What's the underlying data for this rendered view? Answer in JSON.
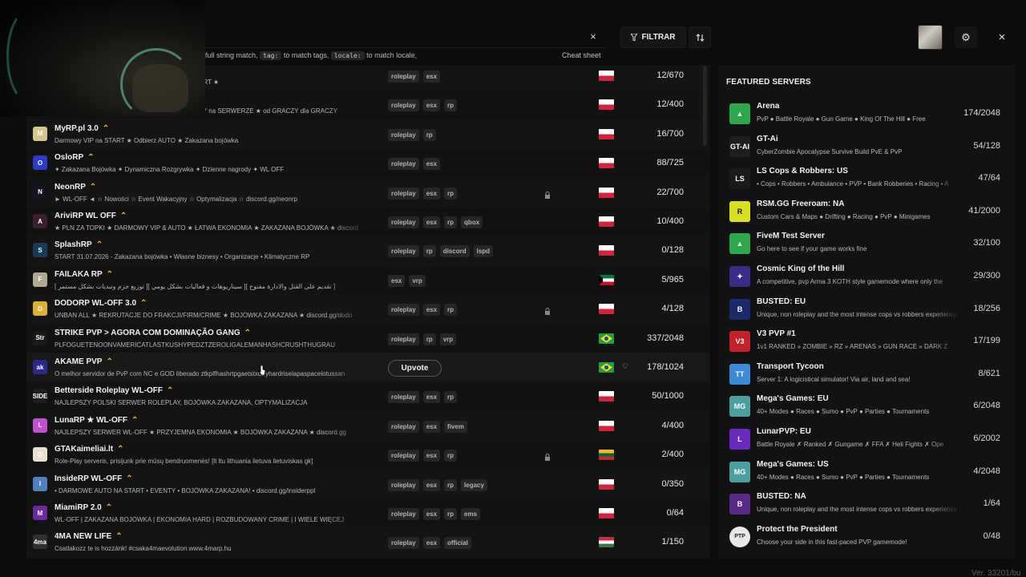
{
  "search": {
    "clear_label": "×",
    "hint_parts": [
      "full string match, ",
      "tag:",
      " to match tags, ",
      "locale:",
      " to match locale,"
    ],
    "cheatsheet_label": "Cheat sheet"
  },
  "toolbar": {
    "filter_label": "FILTRAR",
    "settings_icon": "gear-icon",
    "close_label": "×"
  },
  "servers": [
    {
      "name": "",
      "boost": false,
      "desc": "★ NOWA PACZKA ★ UNBAN ALL ★ AUTO NA START ★",
      "tags": [
        "roleplay",
        "esx"
      ],
      "locked": false,
      "flag": "pl",
      "players": "12/670",
      "icon": "#7a2b2b",
      "icon_text": ""
    },
    {
      "name": "",
      "boost": false,
      "desc": "Zakazana BOJÓWKA ★ SAMOCHODY za GODZINY na SERWERZE ★ od GRACZY dla GRACZY",
      "tags": [
        "roleplay",
        "esx",
        "rp"
      ],
      "locked": false,
      "flag": "pl",
      "players": "12/400",
      "icon": "#333",
      "icon_text": ""
    },
    {
      "name": "MyRP.pl 3.0",
      "boost": true,
      "desc": "Darmowy VIP na START ★ Odbierz AUTO ★ Zakazana bojówka",
      "tags": [
        "roleplay",
        "rp"
      ],
      "locked": false,
      "flag": "pl",
      "players": "16/700",
      "icon": "#d6c68a",
      "icon_text": "M"
    },
    {
      "name": "OsloRP",
      "boost": true,
      "desc": "✦ Zakazana Bojówka ✦ Dynamiczna Rozgrywka ✦ Dzienne nagrody ✦ WL OFF",
      "tags": [
        "roleplay",
        "esx"
      ],
      "locked": false,
      "flag": "pl",
      "players": "88/725",
      "icon": "#2a3cc8",
      "icon_text": "O"
    },
    {
      "name": "NeonRP",
      "boost": true,
      "desc": "► WL-OFF ◄ ☆ Nowości ☆ Event Wakacyjny ☆ Optymalizacja ☆ discord.gg/neonrp",
      "tags": [
        "roleplay",
        "esx",
        "rp"
      ],
      "locked": true,
      "flag": "pl",
      "players": "22/700",
      "icon": "#14141e",
      "icon_text": "N"
    },
    {
      "name": "AriviRP WL OFF",
      "boost": true,
      "desc": "★ PLN ZA TOPKI ★ DARMOWY VIP & AUTO ★ ŁATWA EKONOMIA ★ ZAKAZANA BOJÓWKA ★ discord",
      "tags": [
        "roleplay",
        "esx",
        "rp",
        "qbox"
      ],
      "locked": false,
      "flag": "pl",
      "players": "10/400",
      "icon": "#3a1f2e",
      "icon_text": "A"
    },
    {
      "name": "SplashRP",
      "boost": true,
      "desc": "START 31.07.2026 - Zakazana bojówka • Własne biznesy • Organizacje • Klimatyczne RP",
      "tags": [
        "roleplay",
        "rp",
        "discord",
        "lspd"
      ],
      "locked": false,
      "flag": "pl",
      "players": "0/128",
      "icon": "#1a3a5c",
      "icon_text": "S"
    },
    {
      "name": "FAILAKA RP",
      "boost": true,
      "desc": "[ توزيع حزم وتبديات بشكل مستمر ][ سيناريوهات و فعاليات بشكل يومي ][ تقديم على القتل والادارة مفتوح ]",
      "tags": [
        "esx",
        "vrp"
      ],
      "locked": false,
      "flag": "kw",
      "players": "5/965",
      "icon": "#b0a890",
      "icon_text": "F"
    },
    {
      "name": "DODORP WL-OFF 3.0",
      "boost": true,
      "desc": "UNBAN ALL ★ REKRUTACJE DO FRAKCJI/FIRM/CRIME ★ BOJOWKA ZAKAZANA ★ discord.gg/dodo",
      "tags": [
        "roleplay",
        "esx",
        "rp"
      ],
      "locked": true,
      "flag": "pl",
      "players": "4/128",
      "icon": "#e0b030",
      "icon_text": "D"
    },
    {
      "name": "STRIKE PVP > AGORA COM DOMINAÇÃO GANG",
      "boost": true,
      "desc": "PLFOGUETENOONVAMERICATLASTKUSHYPEDZTZEROLIGALEMANHASHCRUSHTHUGRAU",
      "tags": [
        "roleplay",
        "rp",
        "vrp"
      ],
      "locked": false,
      "flag": "br",
      "players": "337/2048",
      "icon": "#1a1a1a",
      "icon_text": "Str"
    },
    {
      "name": "AKAME PVP",
      "boost": true,
      "desc": "O melhor servidor de PvP com NC e GOD liberado ztkplfhashrtpgaetstxdtryhardriselapaspacelotussan",
      "tags": [],
      "locked": false,
      "flag": "br",
      "players": "178/1024",
      "icon": "#2a2a8a",
      "icon_text": "ak",
      "hover": true,
      "upvote_label": "Upvote",
      "heart": "♡"
    },
    {
      "name": "Betterside Roleplay WL-OFF",
      "boost": true,
      "desc": "NAJLEPSZY POLSKI SERWER ROLEPLAY, BOJÓWKA ZAKAZANA, OPTYMALIZACJA",
      "tags": [
        "roleplay",
        "esx",
        "rp"
      ],
      "locked": false,
      "flag": "pl",
      "players": "50/1000",
      "icon": "#1e1e1e",
      "icon_text": "SIDE"
    },
    {
      "name": "LunaRP ★ WL-OFF",
      "boost": true,
      "desc": "NAJLEPSZY SERWER WL-OFF ★ PRZYJEMNA EKONOMIA ★ BOJÓWKA ZAKAZANA ★ discord.gg",
      "tags": [
        "roleplay",
        "esx",
        "fivem"
      ],
      "locked": false,
      "flag": "pl",
      "players": "4/400",
      "icon": "#c050d0",
      "icon_text": "L"
    },
    {
      "name": "GTAKaimeliai.lt",
      "boost": true,
      "desc": "Role-Play serveris, prisijunk prie mūsų bendruomenės! [lt ltu lithuania lietuva lietuviskas gk]",
      "tags": [
        "roleplay",
        "esx",
        "rp"
      ],
      "locked": true,
      "flag": "lt",
      "players": "2/400",
      "icon": "#e8e0d0",
      "icon_text": "G"
    },
    {
      "name": "InsideRP WL-OFF",
      "boost": true,
      "desc": "• DARMOWE AUTO NA START • EVENTY • BOJÓWKA ZAKAZANA! • discord.gg/insiderppl",
      "tags": [
        "roleplay",
        "esx",
        "rp",
        "legacy"
      ],
      "locked": false,
      "flag": "pl",
      "players": "0/350",
      "icon": "#5080c0",
      "icon_text": "I"
    },
    {
      "name": "MiamiRP 2.0",
      "boost": true,
      "desc": "WL-OFF | ZAKAZANA BOJÓWKA | EKONOMIA HARD | ROZBUDOWANY CRIME | I WIELE WIĘCEJ",
      "tags": [
        "roleplay",
        "esx",
        "rp",
        "ems"
      ],
      "locked": false,
      "flag": "pl",
      "players": "0/64",
      "icon": "#6a2aa0",
      "icon_text": "M"
    },
    {
      "name": "4MA NEW LIFE",
      "boost": true,
      "desc": "Csatlakozz te is hozzánk! #csaka4maevolution www.4marp.hu",
      "tags": [
        "roleplay",
        "esx",
        "official"
      ],
      "locked": false,
      "flag": "hu",
      "players": "1/150",
      "icon": "#303030",
      "icon_text": "4ma"
    }
  ],
  "featured": {
    "title": "FEATURED SERVERS",
    "items": [
      {
        "name": "Arena",
        "desc": "PvP ● Battle Royale ● Gun Game ● King Of The Hill ● Free",
        "players": "174/2048",
        "icon": "#2aa84a",
        "icon_text": "▲"
      },
      {
        "name": "GT-Ai",
        "desc": "CyberZombie Apocalypse Survive Build PvE & PvP",
        "players": "54/128",
        "icon": "#1e1e1e",
        "icon_text": "GT-AI"
      },
      {
        "name": "LS Cops & Robbers: US",
        "desc": "• Cops • Robbers • Ambulance • PVP • Bank Robberies • Racing • A",
        "players": "47/64",
        "icon": "#1a1a1a",
        "icon_text": "LS"
      },
      {
        "name": "RSM.GG Freeroam: NA",
        "desc": "Custom Cars & Maps ● Drifting ● Racing ● PvP ● Minigames",
        "players": "41/2000",
        "icon": "#d8e020",
        "icon_text": "R"
      },
      {
        "name": "FiveM Test Server",
        "desc": "Go here to see if your game works fine",
        "players": "32/100",
        "icon": "#2aa84a",
        "icon_text": "▲"
      },
      {
        "name": "Cosmic King of the Hill",
        "desc": "A competitive, pvp Arma 3 KOTH style gamemode where only the",
        "players": "29/300",
        "icon": "#3a2a8a",
        "icon_text": "✦"
      },
      {
        "name": "BUSTED: EU",
        "desc": "Unique, non roleplay and the most intense cops vs robbers experience",
        "players": "18/256",
        "icon": "#1a2a6a",
        "icon_text": "B"
      },
      {
        "name": "V3 PVP #1",
        "desc": "1v1 RANKED » ZOMBIE » RZ » ARENAS » GUN RACE » DARK Z",
        "players": "17/199",
        "icon": "#c8202a",
        "icon_text": "V3"
      },
      {
        "name": "Transport Tycoon",
        "desc": "Server 1: A logicistical simulator! Via air, land and sea!",
        "players": "8/621",
        "icon": "#3a8ad8",
        "icon_text": "TT"
      },
      {
        "name": "Mega's Games: EU",
        "desc": "40+ Modes ● Races ● Sumo ● PvP ● Parties ● Tournaments",
        "players": "6/2048",
        "icon": "#4aa0a0",
        "icon_text": "MG"
      },
      {
        "name": "LunarPVP: EU",
        "desc": "Battle Royale ✗ Ranked ✗ Gungame ✗ FFA ✗ Heli Fights ✗ Ope",
        "players": "6/2002",
        "icon": "#6a2ac0",
        "icon_text": "L"
      },
      {
        "name": "Mega's Games: US",
        "desc": "40+ Modes ● Races ● Sumo ● PvP ● Parties ● Tournaments",
        "players": "4/2048",
        "icon": "#4aa0a0",
        "icon_text": "MG"
      },
      {
        "name": "BUSTED: NA",
        "desc": "Unique, non roleplay and the most intense cops vs robbers experience",
        "players": "1/64",
        "icon": "#5a2a8a",
        "icon_text": "B"
      },
      {
        "name": "Protect the President",
        "desc": "Choose your side in this fast-paced PVP gamemode!",
        "players": "0/48",
        "icon": "#e8e8e8",
        "icon_text": "PTP"
      }
    ]
  },
  "version": "Ver. 33201/bu",
  "colors": {
    "boost": "#f0b53a",
    "panel": "#121212",
    "background": "#0c0c0c"
  }
}
